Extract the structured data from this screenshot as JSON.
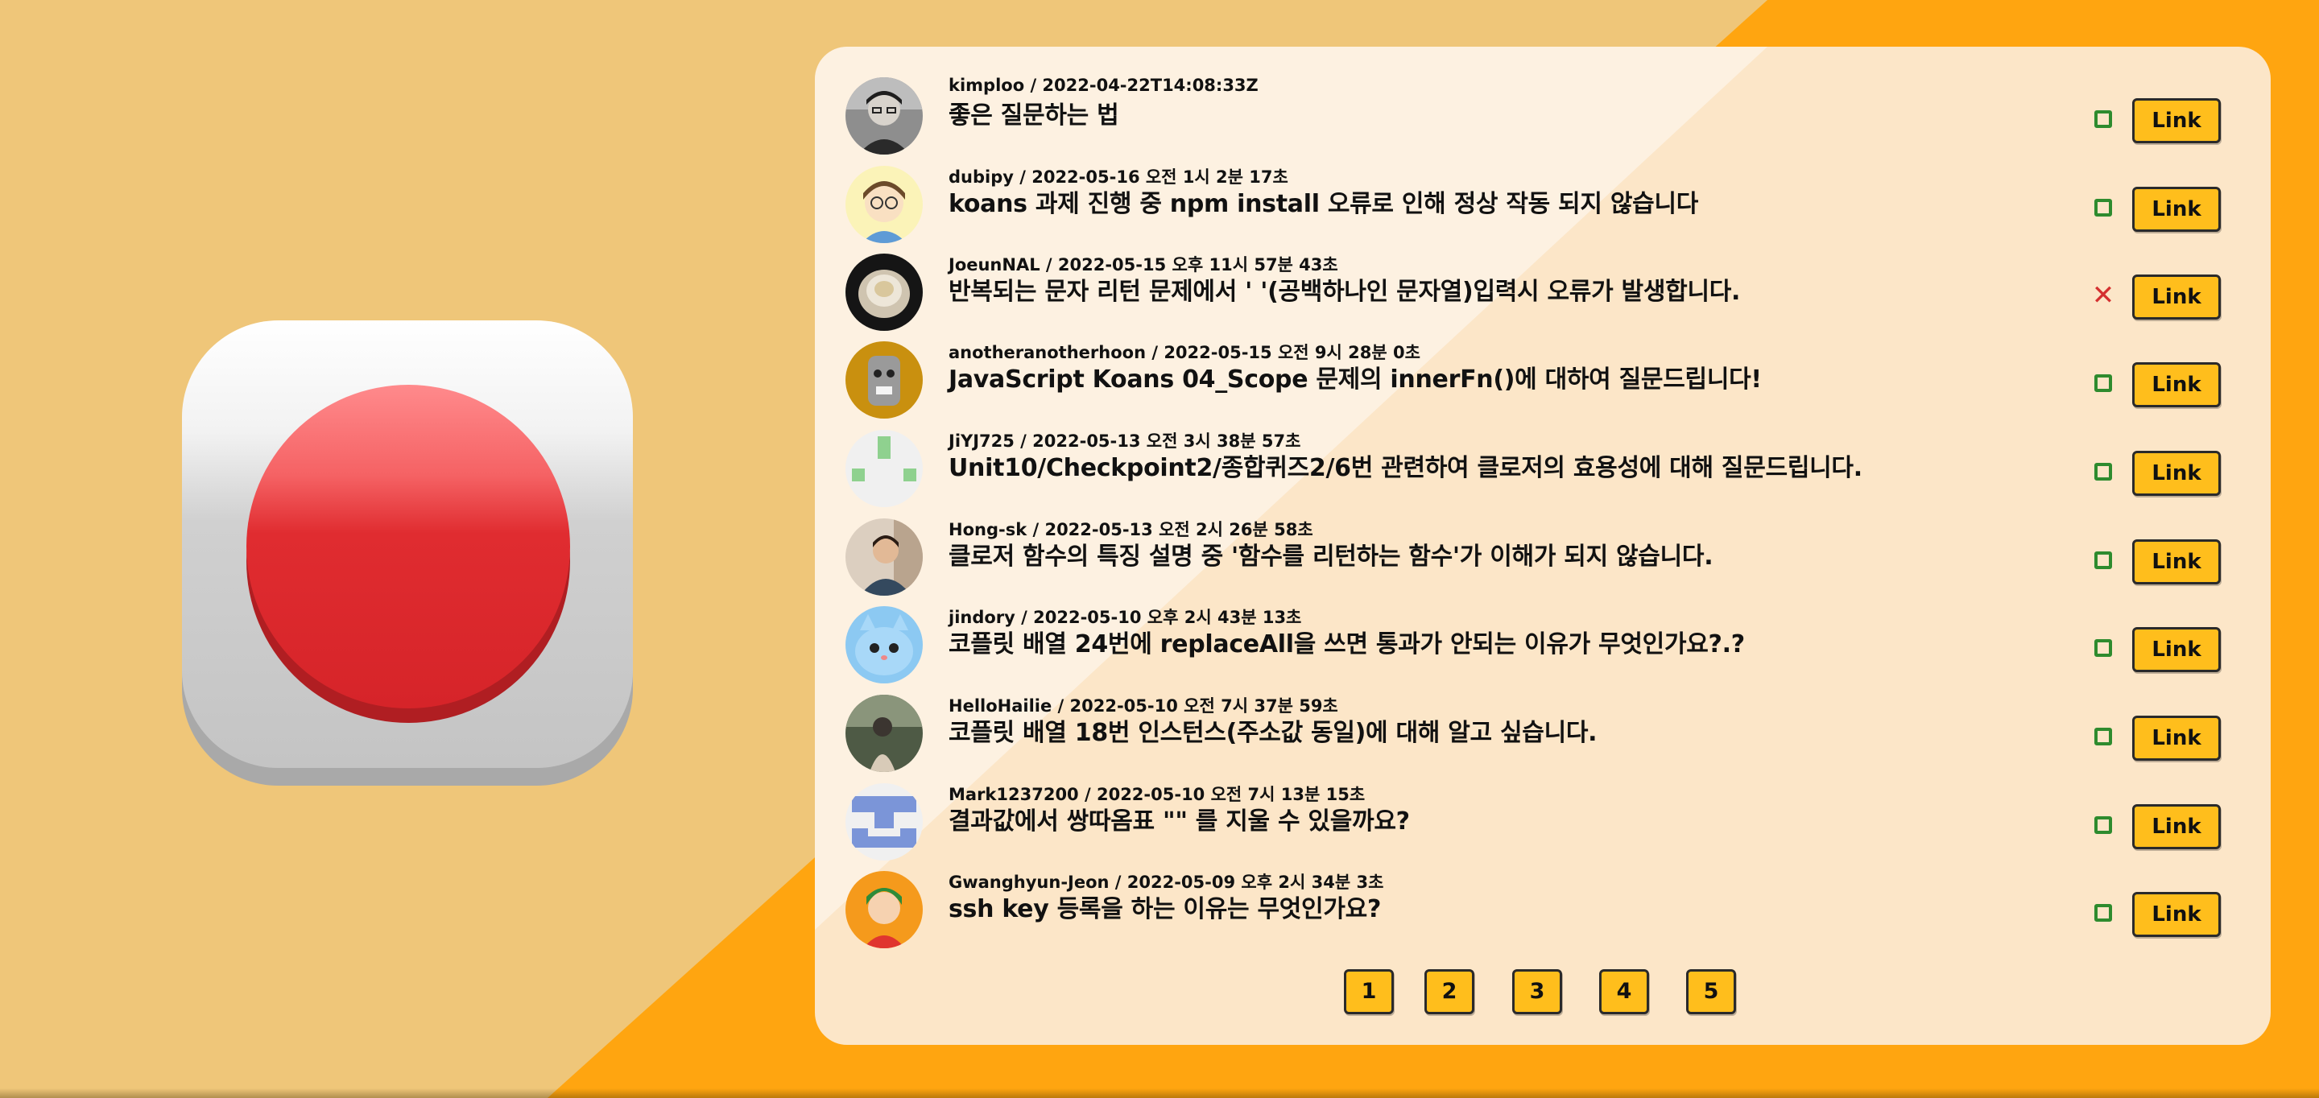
{
  "colors": {
    "background": "#EFC679",
    "background_diagonal": "#FFA510",
    "panel": "#FCE6C8",
    "button_yellow": "#FFBE1C",
    "status_ok": "#2E8B2E",
    "status_error": "#D43030",
    "big_button_red": "#E02C30"
  },
  "big_button": {
    "icon": "red-push-button-icon"
  },
  "questions": [
    {
      "meta": "kimploo / 2022-04-22T14:08:33Z",
      "title": "좋은 질문하는 법",
      "status": "O",
      "link_label": "Link",
      "avatar": "avatar-photo-glasses"
    },
    {
      "meta": "dubipy / 2022-05-16 오전 1시 2분 17초",
      "title": "koans 과제 진행 중 npm install 오류로 인해 정상 작동 되지 않습니다",
      "status": "O",
      "link_label": "Link",
      "avatar": "avatar-cartoon-boy"
    },
    {
      "meta": "JoeunNAL / 2022-05-15 오후 11시 57분 43초",
      "title": "반복되는 문자 리턴 문제에서 ' '(공백하나인 문자열)입력시 오류가 발생합니다.",
      "status": "X",
      "link_label": "Link",
      "avatar": "avatar-dumpling"
    },
    {
      "meta": "anotheranotherhoon / 2022-05-15 오전 9시 28분 0초",
      "title": "JavaScript Koans 04_Scope 문제의 innerFn()에 대하여 질문드립니다!",
      "status": "O",
      "link_label": "Link",
      "avatar": "avatar-cat-figure"
    },
    {
      "meta": "JiYJ725 / 2022-05-13 오전 3시 38분 57초",
      "title": "Unit10/Checkpoint2/종합퀴즈2/6번 관련하여 클로저의 효용성에 대해 질문드립니다.",
      "status": "O",
      "link_label": "Link",
      "avatar": "avatar-identicon-green"
    },
    {
      "meta": "Hong-sk / 2022-05-13 오전 2시 26분 58초",
      "title": "클로저 함수의 특징 설명 중 '함수를 리턴하는 함수'가 이해가 되지 않습니다.",
      "status": "O",
      "link_label": "Link",
      "avatar": "avatar-photo-person"
    },
    {
      "meta": "jindory / 2022-05-10 오후 2시 43분 13초",
      "title": "코플릿 배열 24번에 replaceAll을 쓰면 통과가 안되는 이유가 무엇인가요?.?",
      "status": "O",
      "link_label": "Link",
      "avatar": "avatar-blue-cat"
    },
    {
      "meta": "HelloHailie / 2022-05-10 오전 7시 37분 59초",
      "title": "코플릿 배열 18번 인스턴스(주소값 동일)에 대해 알고 싶습니다.",
      "status": "O",
      "link_label": "Link",
      "avatar": "avatar-photo-outdoor"
    },
    {
      "meta": "Mark1237200 / 2022-05-10 오전 7시 13분 15초",
      "title": "결과값에서 쌍따옴표 \"\" 를 지울 수 있을까요?",
      "status": "O",
      "link_label": "Link",
      "avatar": "avatar-identicon-blue"
    },
    {
      "meta": "Gwanghyun-Jeon / 2022-05-09 오후 2시 34분 3초",
      "title": "ssh key 등록을 하는 이유는 무엇인가요?",
      "status": "O",
      "link_label": "Link",
      "avatar": "avatar-cartoon-green-hair"
    }
  ],
  "pagination": [
    "1",
    "2",
    "3",
    "4",
    "5"
  ]
}
